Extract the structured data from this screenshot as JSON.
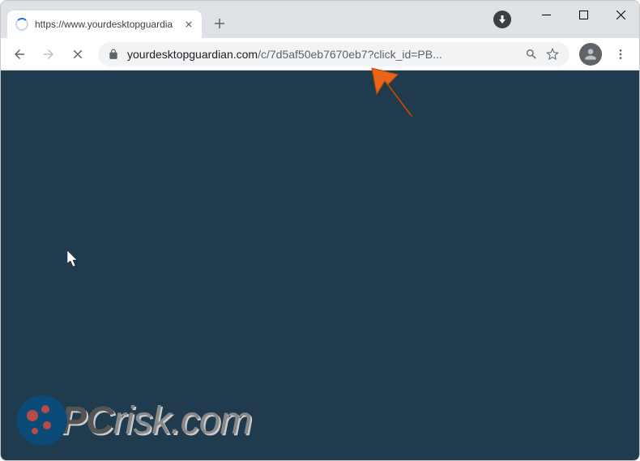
{
  "tab": {
    "title": "https://www.yourdesktopguardia"
  },
  "omnibox": {
    "domain": "yourdesktopguardian.com",
    "path": "/c/7d5af50eb7670eb7?click_id=PB..."
  },
  "watermark": {
    "brand_prefix": "PC",
    "brand_mid": "risk",
    "brand_suffix": ".com"
  }
}
